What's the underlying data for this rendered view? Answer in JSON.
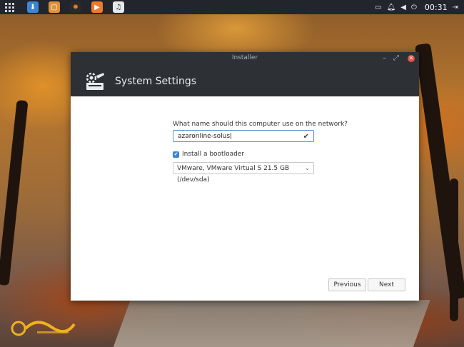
{
  "panel": {
    "clock": "00:31",
    "launcher_icon": "grid-icon",
    "taskbar_apps": [
      "installer-icon",
      "files-icon",
      "game-icon",
      "video-player-icon",
      "music-icon"
    ]
  },
  "window": {
    "title": "Installer",
    "header_title": "System Settings",
    "hostname_question": "What name should this computer use on the network?",
    "hostname_value": "azaronline-solus",
    "bootloader_label": "Install a bootloader",
    "bootloader_checked": true,
    "boot_device": "VMware, VMware Virtual S 21.5 GB (/dev/sda)",
    "previous_label": "Previous",
    "next_label": "Next"
  },
  "watermark": {
    "text": "آذرآنلاین"
  },
  "colors": {
    "panel_bg": "#22252b",
    "window_header_bg": "#2d3035",
    "accent": "#3d84d6",
    "close_button": "#e0544a"
  }
}
